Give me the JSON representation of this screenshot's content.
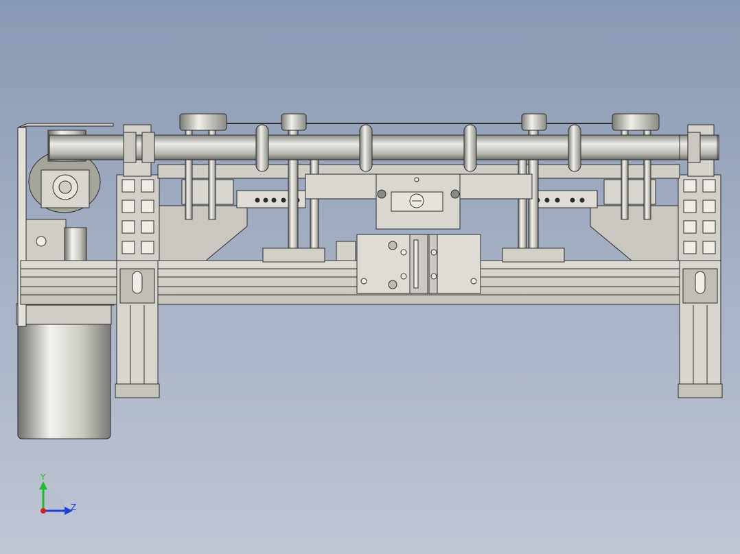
{
  "view": {
    "background_top": "#8899b3",
    "background_bottom": "#bfc6d4",
    "part_fill": "#d6d4cc",
    "part_shade": "#b9b7ae",
    "line": "#2b2b2b"
  },
  "triad": {
    "y_label": "Y",
    "z_label": "Z",
    "y_color": "#1bbf2a",
    "z_color": "#1f3fd6",
    "x_color": "#d61f1f"
  }
}
